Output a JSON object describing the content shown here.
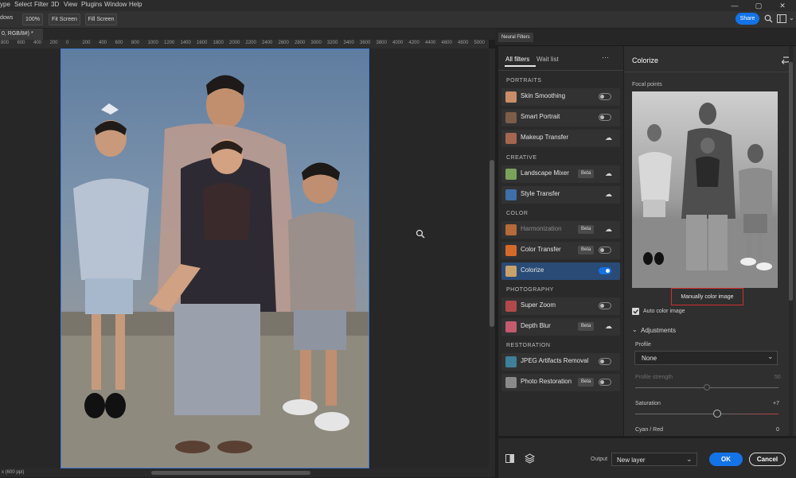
{
  "menu": {
    "items": [
      "ype",
      "Select",
      "Filter",
      "3D",
      "View",
      "Plugins",
      "Window",
      "Help"
    ]
  },
  "window_controls": {
    "minimize": "—",
    "maximize": "▢",
    "close": "✕"
  },
  "options_bar": {
    "tool_label": "dows",
    "zoom": "100%",
    "fit_screen": "Fit Screen",
    "fill_screen": "Fill Screen",
    "share": "Share"
  },
  "document": {
    "tab_label": "0, RGB/8#) *",
    "status": "x (600 ppi)"
  },
  "ruler": {
    "ticks": [
      "800",
      "600",
      "400",
      "200",
      "0",
      "200",
      "400",
      "600",
      "800",
      "1000",
      "1200",
      "1400",
      "1600",
      "1800",
      "2000",
      "2200",
      "2400",
      "2600",
      "2800",
      "3000",
      "3200",
      "3400",
      "3600",
      "3800",
      "4000",
      "4200",
      "4400",
      "4600",
      "4800",
      "5000"
    ]
  },
  "neural_filters": {
    "panel_tab": "Neural Filters",
    "tabs": {
      "all": "All filters",
      "wait": "Wait list",
      "more": "···"
    },
    "categories": [
      {
        "name": "PORTRAITS",
        "filters": [
          {
            "label": "Skin Smoothing",
            "badge": "",
            "control": "toggle",
            "on": false,
            "dim": false,
            "color": "#c98d6a"
          },
          {
            "label": "Smart Portrait",
            "badge": "",
            "control": "toggle",
            "on": false,
            "dim": false,
            "color": "#7d5c48"
          },
          {
            "label": "Makeup Transfer",
            "badge": "",
            "control": "cloud",
            "on": false,
            "dim": false,
            "color": "#a46650"
          }
        ]
      },
      {
        "name": "CREATIVE",
        "filters": [
          {
            "label": "Landscape Mixer",
            "badge": "Beta",
            "control": "cloud",
            "on": false,
            "dim": false,
            "color": "#7aa25a"
          },
          {
            "label": "Style Transfer",
            "badge": "",
            "control": "cloud",
            "on": false,
            "dim": false,
            "color": "#3f6fa8"
          }
        ]
      },
      {
        "name": "COLOR",
        "filters": [
          {
            "label": "Harmonization",
            "badge": "Beta",
            "control": "cloud",
            "on": false,
            "dim": true,
            "color": "#b46a3a"
          },
          {
            "label": "Color Transfer",
            "badge": "Beta",
            "control": "toggle",
            "on": false,
            "dim": false,
            "color": "#d46a2a"
          },
          {
            "label": "Colorize",
            "badge": "",
            "control": "toggle",
            "on": true,
            "dim": false,
            "color": "#c9a26a"
          }
        ]
      },
      {
        "name": "PHOTOGRAPHY",
        "filters": [
          {
            "label": "Super Zoom",
            "badge": "",
            "control": "toggle",
            "on": false,
            "dim": false,
            "color": "#b04a4a"
          },
          {
            "label": "Depth Blur",
            "badge": "Beta",
            "control": "cloud",
            "on": false,
            "dim": false,
            "color": "#c25b6e"
          }
        ]
      },
      {
        "name": "RESTORATION",
        "filters": [
          {
            "label": "JPEG Artifacts Removal",
            "badge": "",
            "control": "toggle",
            "on": false,
            "dim": false,
            "color": "#3f7f9a"
          },
          {
            "label": "Photo Restoration",
            "badge": "Beta",
            "control": "toggle",
            "on": false,
            "dim": false,
            "color": "#8a8a8a"
          }
        ]
      }
    ]
  },
  "colorize": {
    "title": "Colorize",
    "focal_points": "Focal points",
    "manual_button": "Manually color image",
    "auto_color_label": "Auto color image",
    "auto_color_checked": true,
    "adjustments_label": "Adjustments",
    "profile_label": "Profile",
    "profile_value": "None",
    "profile_strength_label": "Profile strength",
    "profile_strength_value": "50",
    "saturation_label": "Saturation",
    "saturation_value": "+7",
    "cyan_red_label": "Cyan / Red",
    "cyan_red_value": "0"
  },
  "bottom": {
    "output_label": "Output",
    "output_value": "New layer",
    "ok": "OK",
    "cancel": "Cancel"
  },
  "colors": {
    "accent": "#1473e6",
    "highlight_border": "#d0302f",
    "active_row": "#2a4b76"
  }
}
